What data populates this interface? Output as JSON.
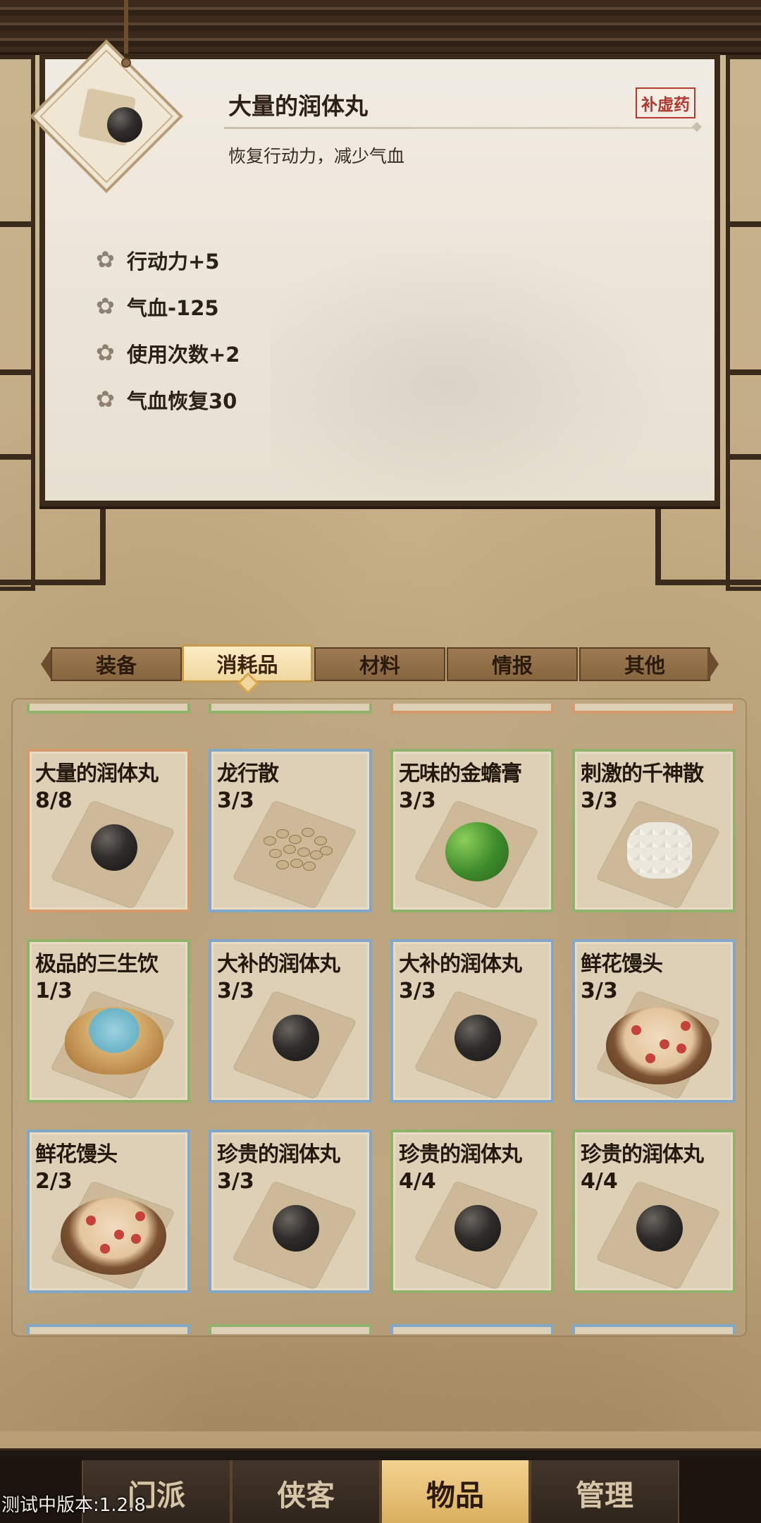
{
  "detail": {
    "title": "大量的润体丸",
    "description": "恢复行动力，减少气血",
    "type_stamp": "补虚药",
    "icon": "black-pill-icon",
    "effects": [
      {
        "text": "行动力+5"
      },
      {
        "text": "气血-125"
      },
      {
        "text": "使用次数+2"
      },
      {
        "text": "气血恢复30"
      }
    ]
  },
  "tabs": [
    {
      "label": "装备"
    },
    {
      "label": "消耗品"
    },
    {
      "label": "材料"
    },
    {
      "label": "情报"
    },
    {
      "label": "其他"
    }
  ],
  "active_tab": "消耗品",
  "items": [
    {
      "name": "大量的润体丸",
      "count": "8/8",
      "icon": "black-pill-icon",
      "rarity": "orange"
    },
    {
      "name": "龙行散",
      "count": "3/3",
      "icon": "grain-powder-icon",
      "rarity": "blue"
    },
    {
      "name": "无味的金蟾膏",
      "count": "3/3",
      "icon": "green-paste-icon",
      "rarity": "green"
    },
    {
      "name": "刺激的千神散",
      "count": "3/3",
      "icon": "white-powder-icon",
      "rarity": "green"
    },
    {
      "name": "极品的三生饮",
      "count": "1/3",
      "icon": "water-bowl-icon",
      "rarity": "green"
    },
    {
      "name": "大补的润体丸",
      "count": "3/3",
      "icon": "black-pill-icon",
      "rarity": "blue"
    },
    {
      "name": "大补的润体丸",
      "count": "3/3",
      "icon": "black-pill-icon",
      "rarity": "blue"
    },
    {
      "name": "鲜花馒头",
      "count": "3/3",
      "icon": "flower-bun-icon",
      "rarity": "blue"
    },
    {
      "name": "鲜花馒头",
      "count": "2/3",
      "icon": "flower-bun-icon",
      "rarity": "blue"
    },
    {
      "name": "珍贵的润体丸",
      "count": "3/3",
      "icon": "black-pill-icon",
      "rarity": "blue"
    },
    {
      "name": "珍贵的润体丸",
      "count": "4/4",
      "icon": "black-pill-icon",
      "rarity": "green"
    },
    {
      "name": "珍贵的润体丸",
      "count": "4/4",
      "icon": "black-pill-icon",
      "rarity": "green"
    }
  ],
  "partial_rows": {
    "top_rarities": [
      "green",
      "green",
      "orange",
      "orange"
    ],
    "bottom_rarities": [
      "blue",
      "green",
      "blue",
      "blue"
    ]
  },
  "nav": [
    {
      "label": "门派"
    },
    {
      "label": "侠客"
    },
    {
      "label": "物品"
    },
    {
      "label": "管理"
    }
  ],
  "active_nav": "物品",
  "version": "测试中版本:1.2.8",
  "colors": {
    "rarity_green": "#8fb36b",
    "rarity_blue": "#83a7c6",
    "rarity_orange": "#d49a6c",
    "active_tab": "#efd79f",
    "stamp_red": "#b03a30"
  }
}
